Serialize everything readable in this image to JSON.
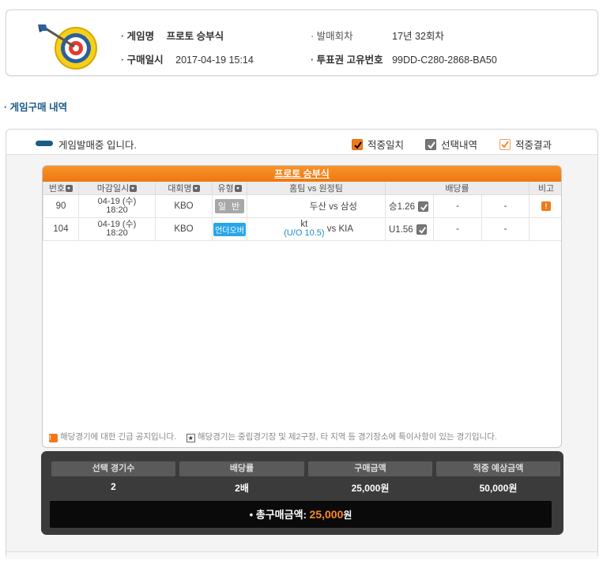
{
  "info": {
    "game_name_label": "게임명",
    "game_name_value": "프로토 승부식",
    "round_label": "발매회차",
    "round_value": "17년 32회차",
    "purchase_time_label": "구매일시",
    "purchase_time_value": "2017-04-19 15:14",
    "ticket_id_label": "투표권 고유번호",
    "ticket_id_value": "99DD-C280-2868-BA50"
  },
  "section_title": "게임구매 내역",
  "status": {
    "text": "게임발매중 입니다.",
    "legend": [
      {
        "label": "적중일치",
        "style": "orange-checked"
      },
      {
        "label": "선택내역",
        "style": "gray-checked"
      },
      {
        "label": "적중결과",
        "style": "outline-checked"
      }
    ]
  },
  "table": {
    "title": "프로토 승부식",
    "columns": [
      "번호",
      "마감일시",
      "대회명",
      "유형",
      "홈팀 vs 원정팀",
      "배당률",
      "비고"
    ],
    "rows": [
      {
        "no": "90",
        "date": "04-19 (수)",
        "time": "18:20",
        "league": "KBO",
        "type": "일 반",
        "type_style": "gray",
        "home": "두산",
        "vs": "vs",
        "away": "삼성",
        "handicap": "",
        "odds": "승1.26",
        "odds2": "-",
        "odds3": "-",
        "note": "!"
      },
      {
        "no": "104",
        "date": "04-19 (수)",
        "time": "18:20",
        "league": "KBO",
        "type": "언더오버",
        "type_style": "blue",
        "home": "kt",
        "vs": "vs",
        "away": "KIA",
        "handicap": "(U/O 10.5)",
        "odds": "U1.56",
        "odds2": "-",
        "odds3": "-",
        "note": ""
      }
    ],
    "footnote_warn": "해당경기에 대한 긴급 공지입니다.",
    "footnote_star": "해당경기는 중립경기장 및 제2구장, 타 지역 등 경기장소에 특이사항이 있는 경기입니다."
  },
  "summary": {
    "headers": [
      "선택 경기수",
      "배당률",
      "구매금액",
      "적중 예상금액"
    ],
    "values": [
      "2",
      "2배",
      "25,000원",
      "50,000원"
    ],
    "total_label": "총구매금액:",
    "total_amount": "25,000",
    "total_unit": "원"
  },
  "colors": {
    "accent_orange": "#f07a1a",
    "accent_blue": "#1a5b8a",
    "underover_blue": "#2aa6e8"
  }
}
